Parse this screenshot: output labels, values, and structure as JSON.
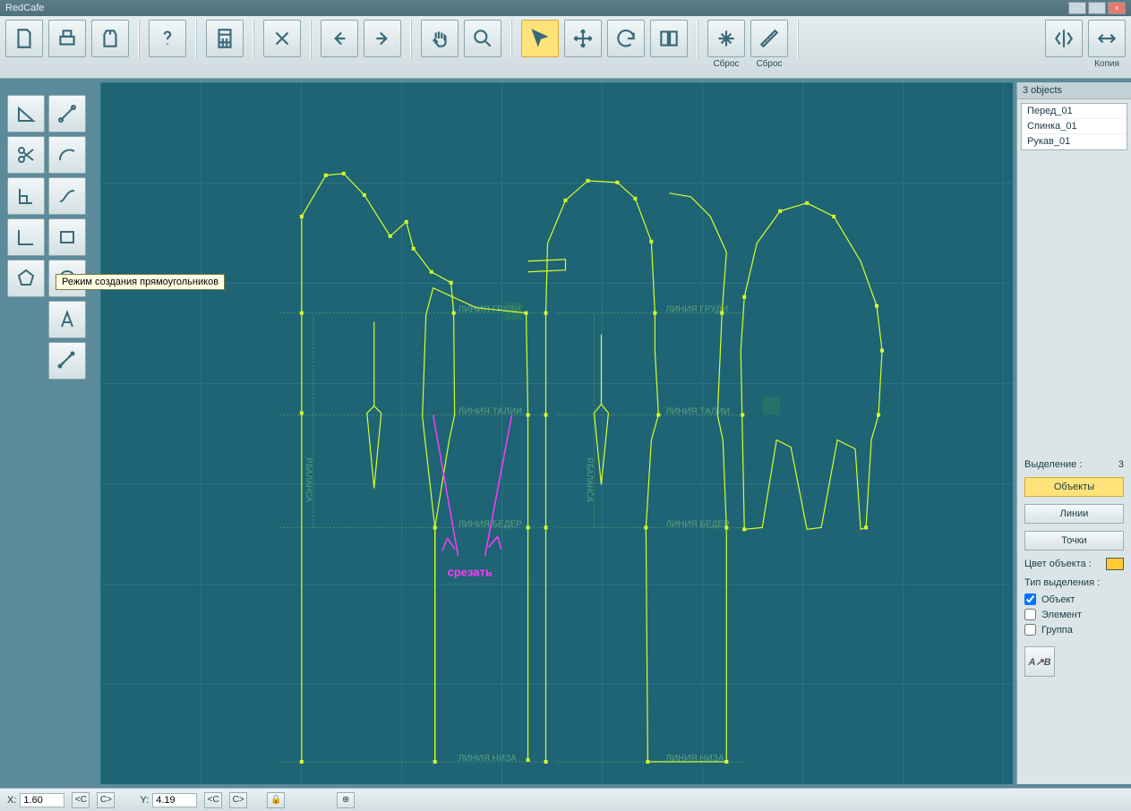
{
  "app": {
    "title": "RedCafe"
  },
  "toolbar": {
    "reset1": "Сброс",
    "reset2": "Сброс",
    "copy": "Копия"
  },
  "tooltip": "Режим создания прямоугольников",
  "canvas": {
    "labels": {
      "chest1": "ЛИНИЯ ГРУДИ",
      "chest2": "ЛИНИЯ ГРУДИ",
      "waist1": "ЛИНИЯ ТАЛИИ",
      "waist2": "ЛИНИЯ ТАЛИИ",
      "hip1": "ЛИНИЯ БЕДЕР",
      "hip2": "ЛИНИЯ БЕДЕР",
      "hem1": "ЛИНИЯ НИЗА",
      "hem2": "ЛИНИЯ НИЗА",
      "balance1": "Р.БАЛАНСА",
      "balance2": "Р.БАЛАНСА",
      "cut": "срезать"
    }
  },
  "panel": {
    "header": "3 objects",
    "items": [
      "Перед_01",
      "Спинка_01",
      "Рукав_01"
    ],
    "sel_label": "Выделение :",
    "sel_count": "3",
    "btn_objects": "Объекты",
    "btn_lines": "Линии",
    "btn_points": "Точки",
    "color_label": "Цвет объекта :",
    "color_value": "#ffcc33",
    "typesel": "Тип выделения :",
    "chk_object": "Объект",
    "chk_element": "Элемент",
    "chk_group": "Группа"
  },
  "status": {
    "xlabel": "X:",
    "xval": "1.60",
    "ylabel": "Y:",
    "yval": "4.19",
    "cbtn": "<C",
    "cbtn2": "C>"
  }
}
